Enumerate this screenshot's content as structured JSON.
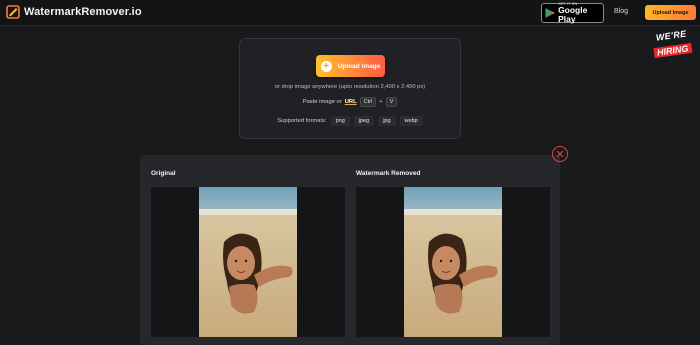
{
  "header": {
    "brand": "WatermarkRemover.io",
    "google_play": {
      "small": "GET IT ON",
      "big": "Google Play"
    },
    "blog_label": "Blog",
    "upload_label": "Upload Image"
  },
  "hiring": {
    "line1": "WE'RE",
    "line2": "HIRING"
  },
  "upload": {
    "button_label": "Upload Image",
    "drop_text": "or drop image anywhere (upto resolution 2,400 x 2,400 px)",
    "paste_text": "Paste image or",
    "url_label": "URL",
    "key_ctrl": "Ctrl",
    "plus": "+",
    "key_v": "V",
    "formats_label": "Supported formats:",
    "formats": [
      "png",
      "jpeg",
      "jpg",
      "webp"
    ]
  },
  "result": {
    "original_label": "Original",
    "removed_label": "Watermark Removed"
  },
  "colors": {
    "accent_start": "#ffc02b",
    "accent_end": "#ff5b44",
    "close": "#e0443e",
    "background": "#191a1c"
  },
  "icons": [
    "logo-icon",
    "play-store-icon",
    "plus-icon",
    "close-icon"
  ]
}
